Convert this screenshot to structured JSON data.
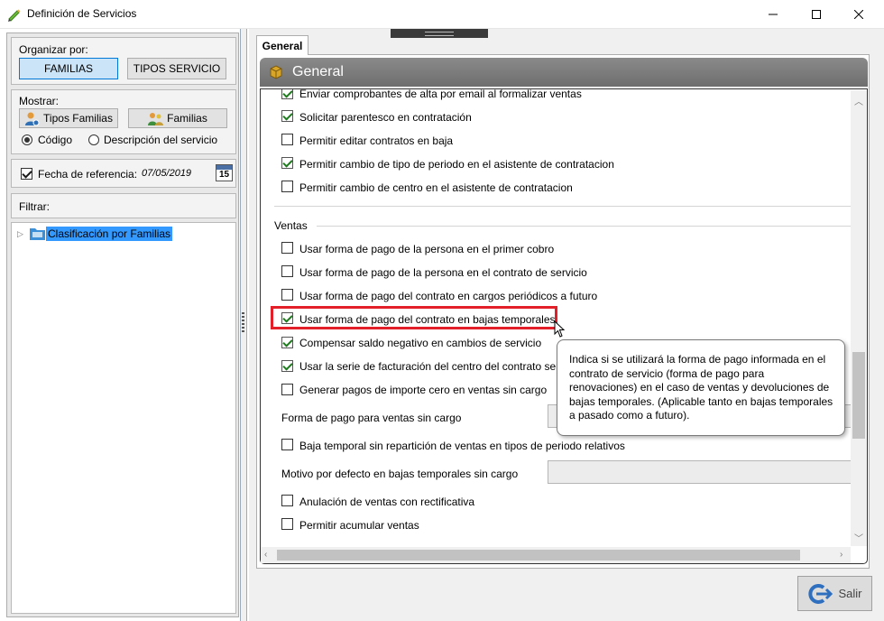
{
  "window": {
    "title": "Definición de Servicios"
  },
  "left": {
    "organizar_label": "Organizar por:",
    "organizar_buttons": [
      "FAMILIAS",
      "TIPOS SERVICIO"
    ],
    "mostrar_label": "Mostrar:",
    "mostrar_buttons": [
      "Tipos Familias",
      "Familias"
    ],
    "radio_codigo": "Código",
    "radio_descripcion": "Descripción del servicio",
    "fecha_label": "Fecha de referencia:",
    "fecha_value": "07/05/2019",
    "calendar_day": "15",
    "filtrar_label": "Filtrar:",
    "tree_root": "Clasificación por Familias"
  },
  "tab": {
    "label": "General",
    "group_title": "General"
  },
  "options_top": [
    {
      "label": "Enviar comprobantes de alta por email al formalizar ventas",
      "checked": true
    },
    {
      "label": "Solicitar parentesco en contratación",
      "checked": true
    },
    {
      "label": "Permitir editar contratos en baja",
      "checked": false
    },
    {
      "label": "Permitir cambio de tipo de periodo en el asistente de contratacion",
      "checked": true
    },
    {
      "label": "Permitir cambio de centro en el asistente de contratacion",
      "checked": false
    }
  ],
  "ventas": {
    "legend": "Ventas",
    "options": [
      {
        "label": "Usar forma de pago de la persona en el primer cobro",
        "checked": false
      },
      {
        "label": "Usar forma de pago de la persona en el contrato de servicio",
        "checked": false
      },
      {
        "label": "Usar forma de pago del contrato en cargos periódicos a futuro",
        "checked": false
      },
      {
        "label": "Usar forma de pago del contrato en bajas temporales",
        "checked": true
      },
      {
        "label": "Compensar saldo negativo en cambios de servicio",
        "checked": true
      },
      {
        "label": "Usar la serie de facturación del centro del contrato seru",
        "checked": true
      },
      {
        "label": "Generar pagos de importe cero en ventas sin cargo",
        "checked": false
      }
    ],
    "forma_pago_label": "Forma de pago para ventas sin cargo",
    "baja_sin_reparticion": "Baja temporal sin repartición de ventas en tipos de periodo relativos",
    "motivo_label": "Motivo por defecto en bajas temporales sin cargo",
    "anulacion": "Anulación de ventas con rectificativa",
    "acumular": "Permitir acumular ventas"
  },
  "tooltip": "Indica si se utilizará la forma de pago informada en el contrato de servicio (forma de pago para renovaciones) en el caso de ventas y devoluciones de bajas temporales. (Aplicable tanto en bajas temporales a pasado como a futuro).",
  "footer": {
    "salir": "Salir"
  },
  "colors": {
    "highlight": "#e3202a",
    "tree_selected": "#3399ff",
    "check_green": "#1f7a1f"
  }
}
